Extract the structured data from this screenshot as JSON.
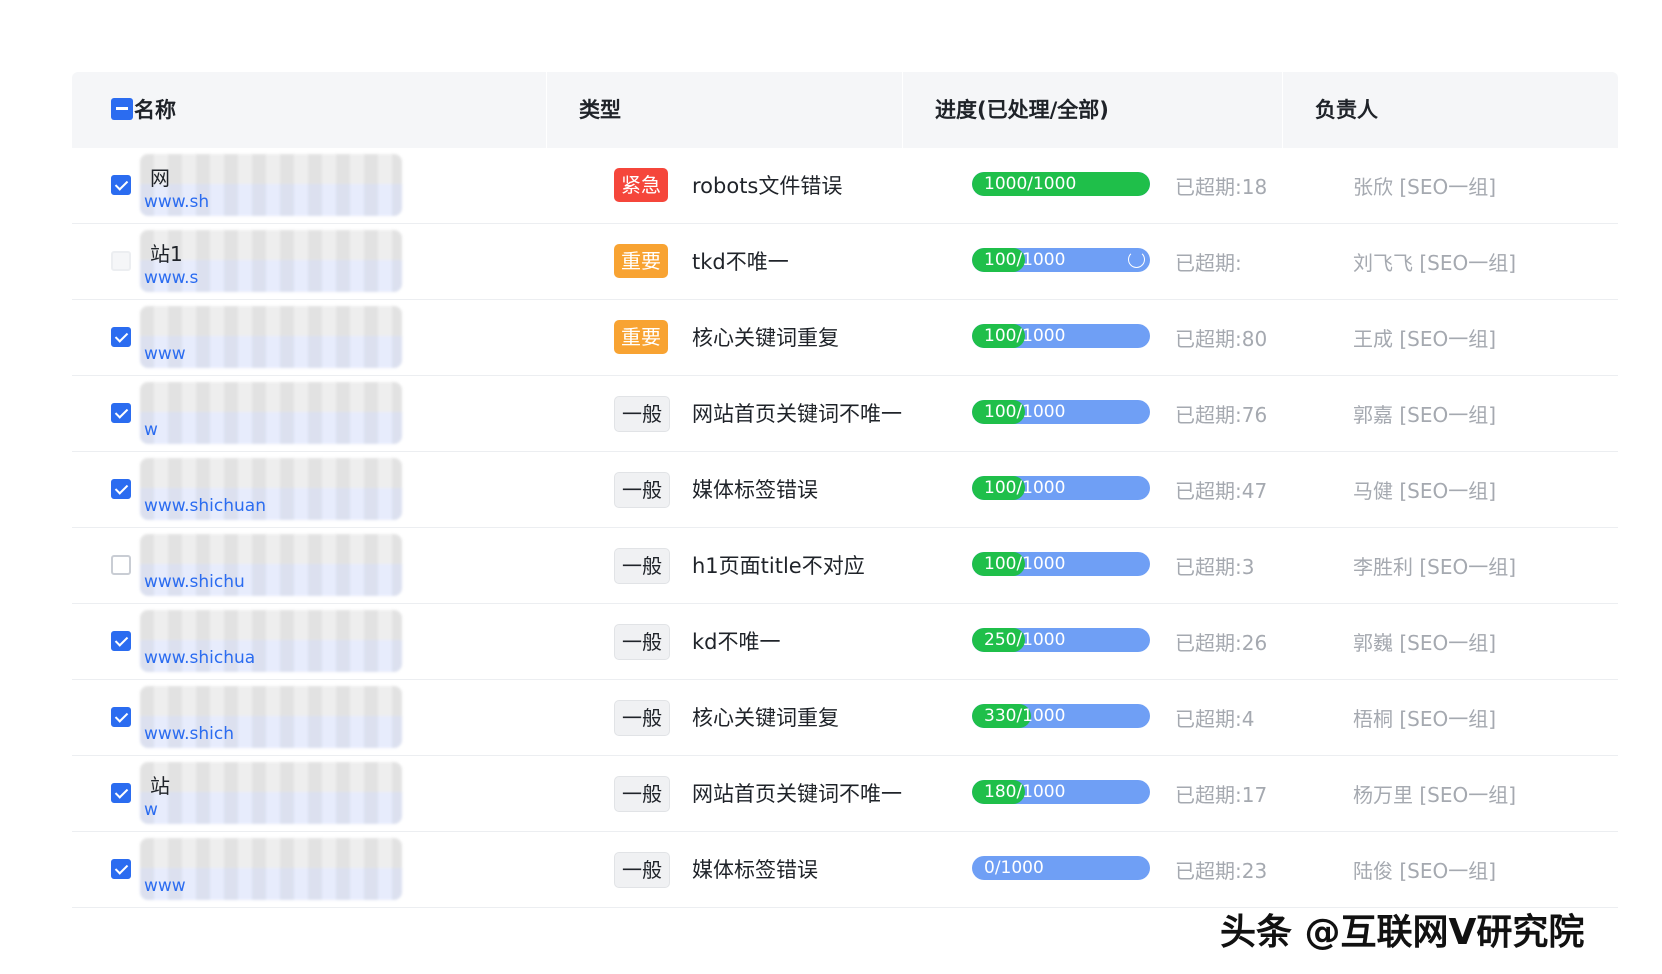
{
  "header": {
    "col_name": "名称",
    "col_type": "类型",
    "col_progress": "进度(已处理/全部)",
    "col_owner": "负责人"
  },
  "colors": {
    "accent": "#2b6cf0",
    "urgent": "#f5463b",
    "important": "#f8a332",
    "progress_done": "#1fbf4a",
    "progress_rest": "#6f9ff5"
  },
  "rows": [
    {
      "checked": true,
      "disabled": false,
      "name": "网",
      "url": "www.sh",
      "priority": "urgent",
      "tag": "紧急",
      "issue": "robots文件错误",
      "done": 1000,
      "total": 1000,
      "progress_text": "1000/1000",
      "overdue": "已超期:18",
      "owner": "张欣 [SEO一组]",
      "loading": false
    },
    {
      "checked": false,
      "disabled": true,
      "name": "站1",
      "url": "www.s",
      "priority": "important",
      "tag": "重要",
      "issue": "tkd不唯一",
      "done": 100,
      "total": 1000,
      "progress_text": "100/1000",
      "overdue": "已超期:",
      "owner": "刘飞飞 [SEO一组]",
      "loading": true
    },
    {
      "checked": true,
      "disabled": false,
      "name": "",
      "url": "www",
      "priority": "important",
      "tag": "重要",
      "issue": "核心关键词重复",
      "done": 100,
      "total": 1000,
      "progress_text": "100/1000",
      "overdue": "已超期:80",
      "owner": "王成 [SEO一组]",
      "loading": false
    },
    {
      "checked": true,
      "disabled": false,
      "name": "",
      "url": "w",
      "priority": "normal",
      "tag": "一般",
      "issue": "网站首页关键词不唯一",
      "done": 100,
      "total": 1000,
      "progress_text": "100/1000",
      "overdue": "已超期:76",
      "owner": "郭嘉 [SEO一组]",
      "loading": false
    },
    {
      "checked": true,
      "disabled": false,
      "name": "",
      "url": "www.shichuan",
      "priority": "normal",
      "tag": "一般",
      "issue": "媒体标签错误",
      "done": 100,
      "total": 1000,
      "progress_text": "100/1000",
      "overdue": "已超期:47",
      "owner": "马健 [SEO一组]",
      "loading": false
    },
    {
      "checked": false,
      "disabled": false,
      "name": "",
      "url": "www.shichu",
      "priority": "normal",
      "tag": "一般",
      "issue": "h1页面title不对应",
      "done": 100,
      "total": 1000,
      "progress_text": "100/1000",
      "overdue": "已超期:3",
      "owner": "李胜利 [SEO一组]",
      "loading": false
    },
    {
      "checked": true,
      "disabled": false,
      "name": "",
      "url": "www.shichua",
      "priority": "normal",
      "tag": "一般",
      "issue": "kd不唯一",
      "done": 250,
      "total": 1000,
      "progress_text": "250/1000",
      "overdue": "已超期:26",
      "owner": "郭巍 [SEO一组]",
      "loading": false
    },
    {
      "checked": true,
      "disabled": false,
      "name": "",
      "url": "www.shich",
      "priority": "normal",
      "tag": "一般",
      "issue": "核心关键词重复",
      "done": 330,
      "total": 1000,
      "progress_text": "330/1000",
      "overdue": "已超期:4",
      "owner": "梧桐 [SEO一组]",
      "loading": false
    },
    {
      "checked": true,
      "disabled": false,
      "name": "站",
      "url": "w",
      "priority": "normal",
      "tag": "一般",
      "issue": "网站首页关键词不唯一",
      "done": 180,
      "total": 1000,
      "progress_text": "180/1000",
      "overdue": "已超期:17",
      "owner": "杨万里 [SEO一组]",
      "loading": false
    },
    {
      "checked": true,
      "disabled": false,
      "name": "",
      "url": "www",
      "priority": "normal",
      "tag": "一般",
      "issue": "媒体标签错误",
      "done": 0,
      "total": 1000,
      "progress_text": "0/1000",
      "overdue": "已超期:23",
      "owner": "陆俊 [SEO一组]",
      "loading": false
    }
  ],
  "watermark": "头条 @互联网V研究院"
}
